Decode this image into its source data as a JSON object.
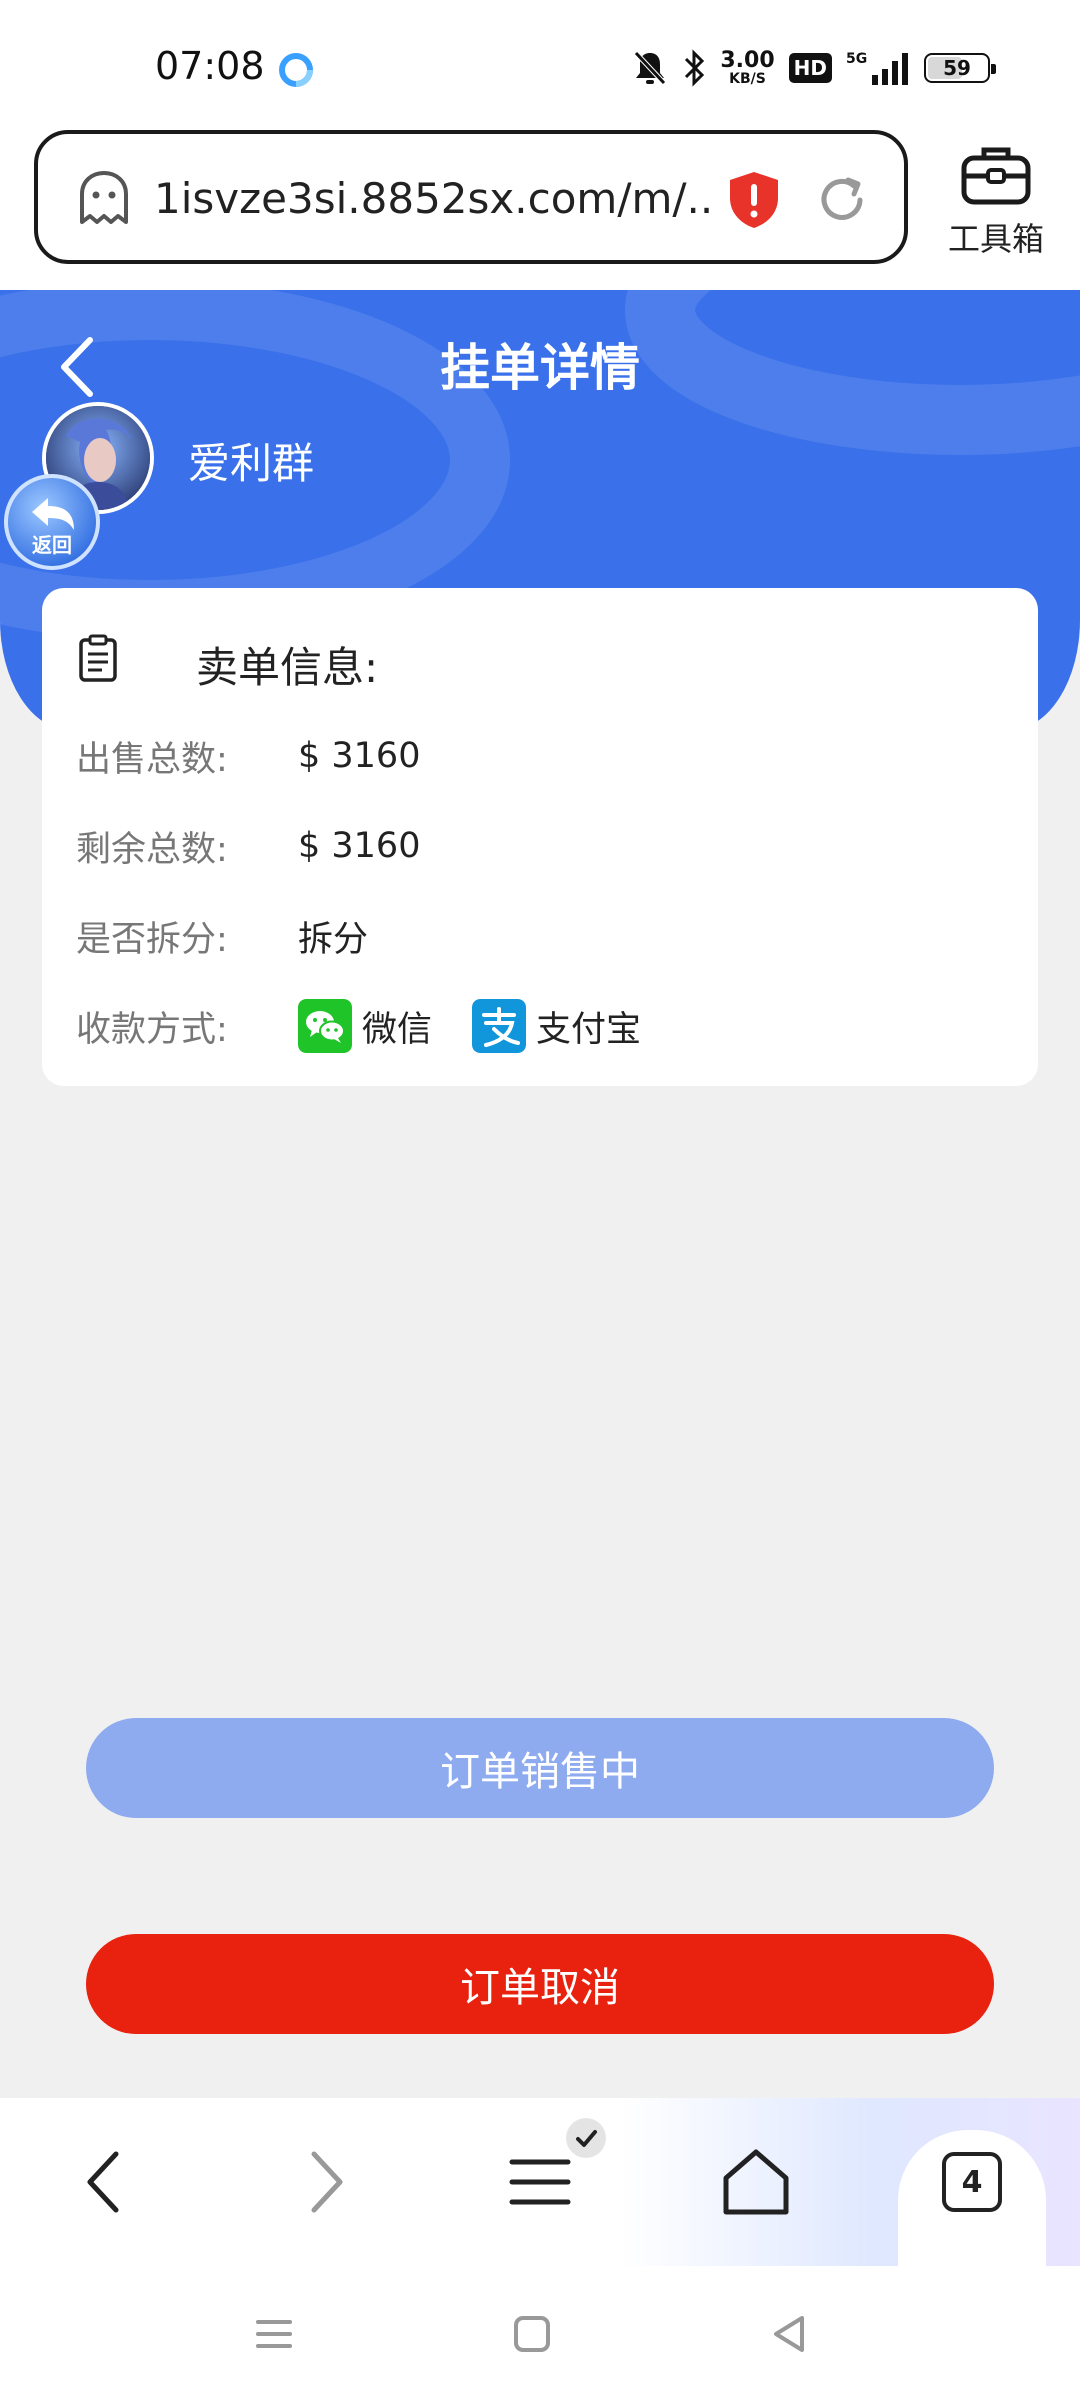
{
  "status_bar": {
    "time": "07:08",
    "net_speed_value": "3.00",
    "net_speed_unit": "KB/S",
    "hd_badge": "HD",
    "network": "5G",
    "battery": "59",
    "battery_level_percent": 59
  },
  "browser": {
    "url": "1isvze3si.8852sx.com/m/...",
    "toolbox_label": "工具箱",
    "tab_count": "4"
  },
  "header": {
    "title": "挂单详情",
    "user_name": "爱利群",
    "back_badge_label": "返回"
  },
  "card": {
    "title": "卖单信息:",
    "rows": [
      {
        "label": "出售总数:",
        "value": "$ 3160"
      },
      {
        "label": "剩余总数:",
        "value": "$ 3160"
      },
      {
        "label": "是否拆分:",
        "value": "拆分"
      },
      {
        "label": "收款方式:"
      }
    ],
    "payment_methods": [
      {
        "name": "微信",
        "icon": "wechat-icon",
        "color": "#1fc429"
      },
      {
        "name": "支付宝",
        "icon": "alipay-icon",
        "color": "#1296db"
      }
    ]
  },
  "buttons": {
    "status_label": "订单销售中",
    "cancel_label": "订单取消"
  },
  "colors": {
    "header_blue": "#3a70ea",
    "status_button": "#8fabef",
    "cancel_button": "#e9220f",
    "page_bg": "#f0f0f0"
  }
}
